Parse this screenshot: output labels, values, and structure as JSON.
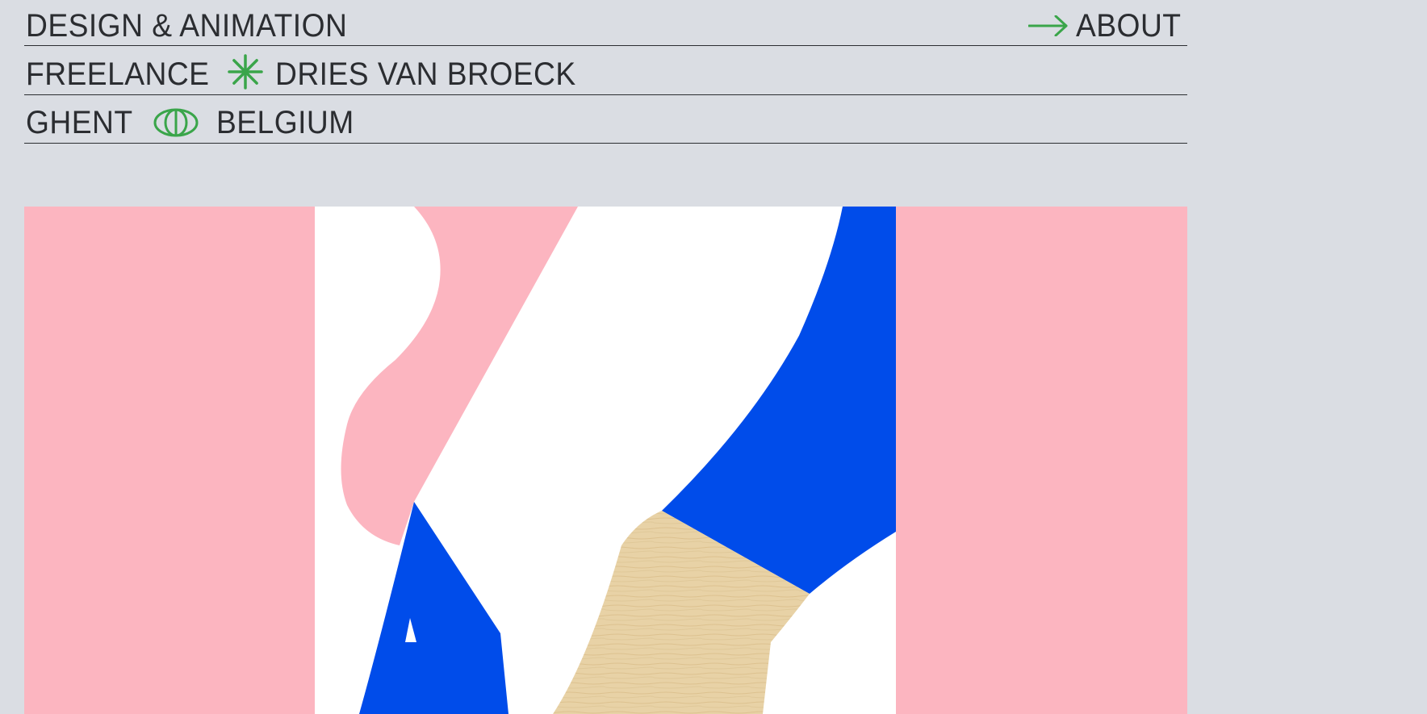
{
  "header": {
    "line1": "DESIGN & ANIMATION",
    "about_label": "ABOUT",
    "line2_left": "FREELANCE",
    "line2_right": "DRIES VAN BROECK",
    "line3_left": "GHENT",
    "line3_right": "BELGIUM"
  },
  "icons": {
    "about_arrow": "arrow-right-icon",
    "asterisk": "asterisk-icon",
    "globe": "globe-icon"
  },
  "colors": {
    "background": "#dadde3",
    "text": "#2b2d31",
    "accent_green": "#3aa54a",
    "pink": "#fcb5c0",
    "blue": "#004cea",
    "white": "#ffffff",
    "wood": "#e8d2a6"
  }
}
